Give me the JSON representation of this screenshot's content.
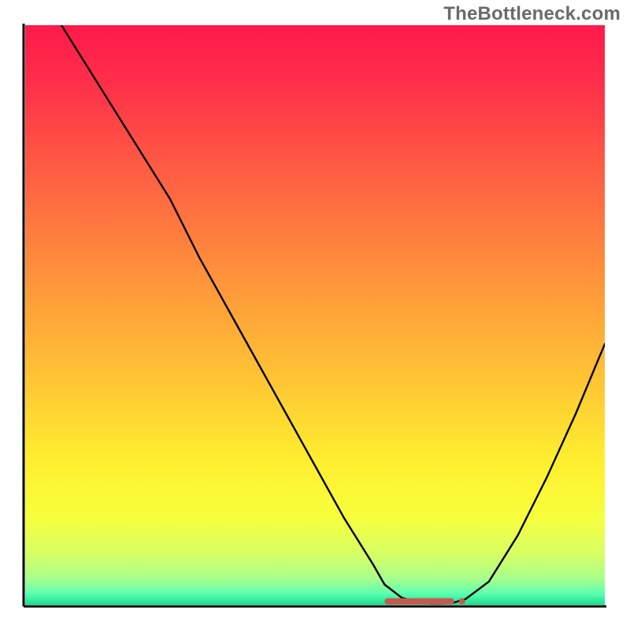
{
  "watermark": "TheBottleneck.com",
  "chart_data": {
    "type": "line",
    "title": "",
    "xlabel": "",
    "ylabel": "",
    "xlim": [
      0,
      100
    ],
    "ylim": [
      0,
      100
    ],
    "grid": false,
    "series": [
      {
        "name": "curve",
        "x": [
          0,
          5,
          10,
          15,
          20,
          25,
          30,
          35,
          40,
          45,
          50,
          55,
          60,
          62,
          65,
          68,
          70,
          72,
          74,
          76,
          80,
          85,
          90,
          95,
          100
        ],
        "y": [
          110,
          102,
          94,
          86,
          78,
          70,
          60,
          51,
          42,
          33,
          24,
          15,
          7,
          3.5,
          1.2,
          0.4,
          0.2,
          0.2,
          0.4,
          1.0,
          4,
          12,
          22,
          33,
          45
        ]
      }
    ],
    "marker": {
      "name": "min-marker",
      "x_start": 62,
      "x_end": 74,
      "y": 0.6,
      "color": "#c35a4f"
    },
    "gradient_stops": [
      {
        "offset": 0.0,
        "color": "#ff1a4b"
      },
      {
        "offset": 0.1,
        "color": "#ff2f4a"
      },
      {
        "offset": 0.22,
        "color": "#ff5444"
      },
      {
        "offset": 0.35,
        "color": "#ff7a3f"
      },
      {
        "offset": 0.48,
        "color": "#ffa039"
      },
      {
        "offset": 0.62,
        "color": "#ffc734"
      },
      {
        "offset": 0.75,
        "color": "#ffee2f"
      },
      {
        "offset": 0.85,
        "color": "#f7ff3d"
      },
      {
        "offset": 0.91,
        "color": "#d8ff63"
      },
      {
        "offset": 0.955,
        "color": "#a8ff8c"
      },
      {
        "offset": 0.98,
        "color": "#5fffb0"
      },
      {
        "offset": 1.0,
        "color": "#18e08f"
      }
    ],
    "curve_color": "#000000",
    "curve_width": 2.4
  }
}
